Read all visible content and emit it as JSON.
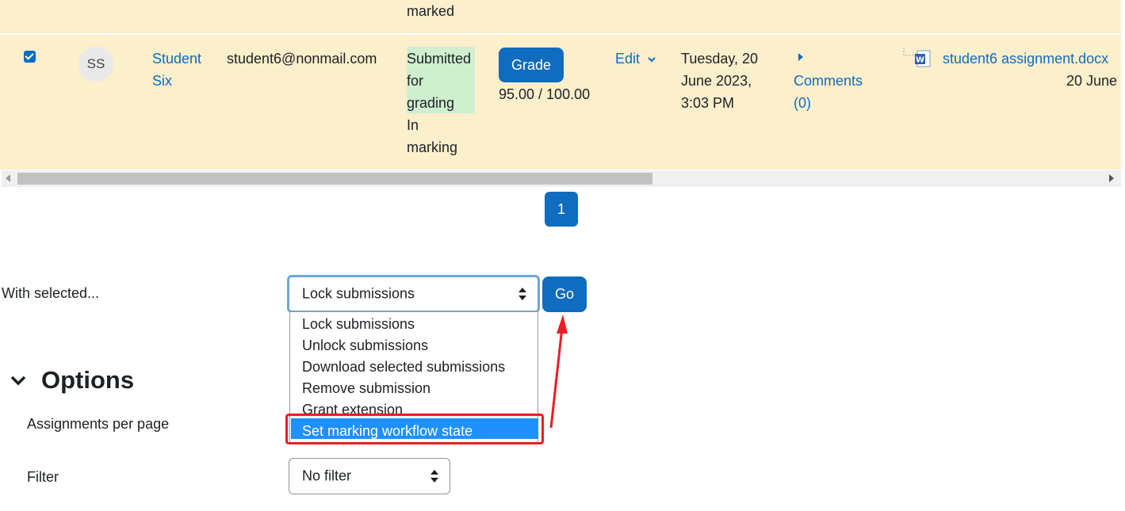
{
  "table": {
    "prev_row_status": "marked",
    "row": {
      "checked": true,
      "avatar_initials": "SS",
      "name_line1": "Student",
      "name_line2": "Six",
      "email": "student6@nonmail.com",
      "status_line1": "Submitted",
      "status_line2": "for",
      "status_line3": "grading",
      "status_line4": "In",
      "status_line5": "marking",
      "grade_button": "Grade",
      "grade_value": "95.00 / 100.00",
      "edit_label": "Edit",
      "modified_line1": "Tuesday, 20",
      "modified_line2": "June 2023,",
      "modified_line3": "3:03 PM",
      "comments_line1": "Comments",
      "comments_line2": "(0)",
      "file_name": "student6 assignment.docx",
      "file_date": "20 June"
    }
  },
  "pagination": {
    "page": "1"
  },
  "bulk": {
    "label": "With selected...",
    "selected": "Lock submissions",
    "go_button": "Go",
    "options": [
      "Lock submissions",
      "Unlock submissions",
      "Download selected submissions",
      "Remove submission",
      "Grant extension",
      "Set marking workflow state"
    ]
  },
  "options": {
    "heading": "Options",
    "per_page_label": "Assignments per page",
    "filter_label": "Filter",
    "filter_value": "No filter"
  },
  "colors": {
    "row_highlight": "#fcefcc",
    "primary": "#0f6cbf",
    "status_green": "#cfefcf",
    "annotation_red": "#ee1c25",
    "dropdown_selected": "#1e90ff"
  }
}
